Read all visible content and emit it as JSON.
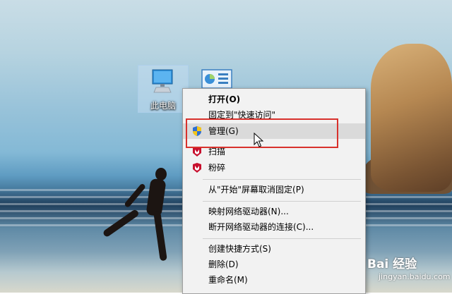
{
  "desktop": {
    "icon_this_pc": {
      "label": "此电脑",
      "icon": "computer-icon"
    },
    "icon_second": {
      "icon": "control-panel-icon"
    }
  },
  "context_menu": {
    "items": [
      {
        "label": "打开(O)",
        "bold": true
      },
      {
        "label": "固定到\"快速访问\""
      },
      {
        "label": "管理(G)",
        "icon": "shield-icon",
        "hover": true
      },
      {
        "label": "扫描",
        "icon": "mcafee-icon"
      },
      {
        "label": "粉碎",
        "icon": "mcafee-icon"
      },
      {
        "label": "从\"开始\"屏幕取消固定(P)"
      },
      {
        "label": "映射网络驱动器(N)..."
      },
      {
        "label": "断开网络驱动器的连接(C)..."
      },
      {
        "label": "创建快捷方式(S)"
      },
      {
        "label": "删除(D)"
      },
      {
        "label": "重命名(M)"
      }
    ]
  },
  "highlight": {
    "color": "#d8312c",
    "target": "管理(G)"
  },
  "watermark": {
    "brand": "Bai 经验",
    "url": "jingyan.baidu.com"
  },
  "colors": {
    "menu_bg": "#f2f2f2",
    "hover_bg": "#dadada",
    "mcafee_red": "#c8102e",
    "highlight_red": "#d8312c"
  }
}
